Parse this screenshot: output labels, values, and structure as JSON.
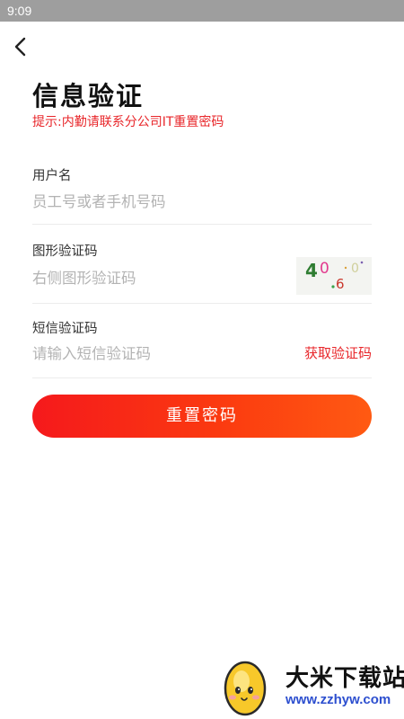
{
  "status_bar": {
    "time": "9:09"
  },
  "header": {
    "back_icon": "chevron-left-icon",
    "title": "信息验证"
  },
  "hint": "提示:内勤请联系分公司IT重置密码",
  "form": {
    "username": {
      "label": "用户名",
      "placeholder": "员工号或者手机号码"
    },
    "captcha": {
      "label": "图形验证码",
      "placeholder": "右侧图形验证码",
      "image_text": "4060"
    },
    "sms": {
      "label": "短信验证码",
      "placeholder": "请输入短信验证码",
      "get_code": "获取验证码"
    }
  },
  "submit_button": "重置密码",
  "watermark": {
    "name": "大米下载站",
    "url": "www.zzhyw.com"
  },
  "colors": {
    "accent": "#e8262a",
    "button_gradient_start": "#f5191c",
    "button_gradient_end": "#ff5a12",
    "status_bar": "#9e9e9e"
  }
}
